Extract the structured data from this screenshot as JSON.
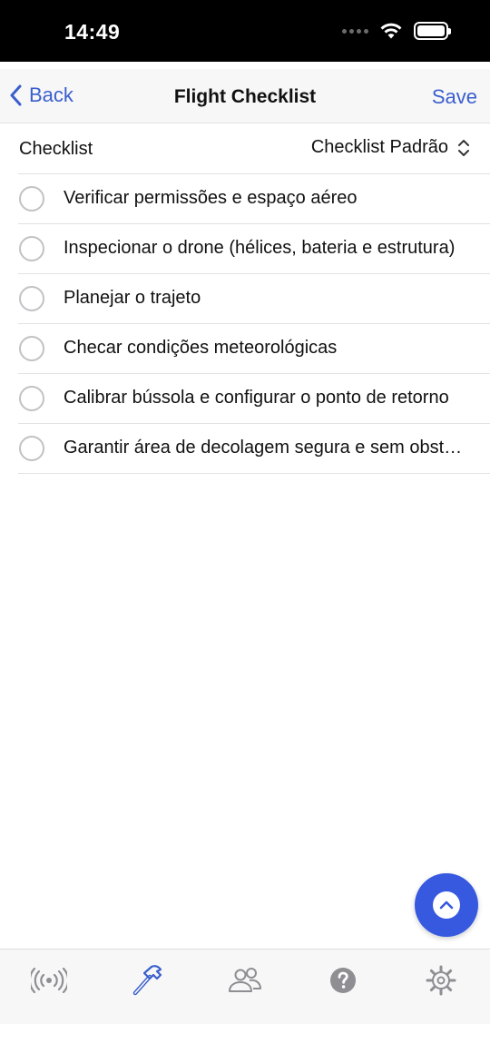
{
  "status_bar": {
    "time": "14:49"
  },
  "nav": {
    "back_label": "Back",
    "title": "Flight Checklist",
    "save_label": "Save"
  },
  "picker": {
    "label": "Checklist",
    "value": "Checklist Padrão"
  },
  "checklist": {
    "items": [
      {
        "text": "Verificar permissões e espaço aéreo",
        "checked": false
      },
      {
        "text": "Inspecionar o drone (hélices, bateria e estrutura)",
        "checked": false
      },
      {
        "text": "Planejar o trajeto",
        "checked": false
      },
      {
        "text": "Checar condições meteorológicas",
        "checked": false
      },
      {
        "text": "Calibrar bússola e configurar o ponto de retorno",
        "checked": false
      },
      {
        "text": "Garantir área de decolagem segura e sem obstáculos",
        "checked": false
      }
    ]
  },
  "fab": {
    "icon": "chevron-up-icon"
  },
  "tab_bar": {
    "tabs": [
      {
        "icon": "broadcast-icon",
        "active": false
      },
      {
        "icon": "hammer-icon",
        "active": true
      },
      {
        "icon": "people-icon",
        "active": false
      },
      {
        "icon": "help-icon",
        "active": false
      },
      {
        "icon": "gear-icon",
        "active": false
      }
    ]
  },
  "colors": {
    "accent": "#3a5fcd",
    "fab": "#3659e0",
    "inactive_icon": "#8e8e93",
    "active_icon": "#3a5fcd"
  }
}
